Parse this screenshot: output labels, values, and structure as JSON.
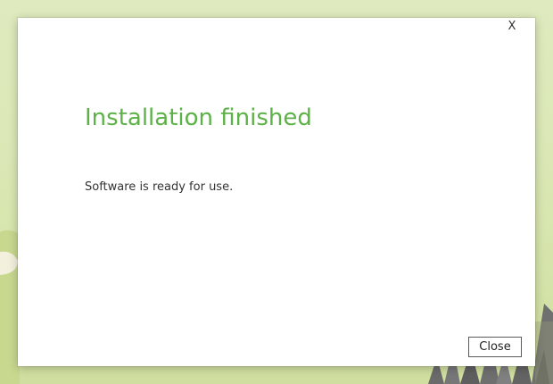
{
  "dialog": {
    "close_glyph": "X",
    "title": "Installation finished",
    "message": "Software is ready for use.",
    "close_button_label": "Close"
  },
  "colors": {
    "title": "#5cb246",
    "background": "#dbe8b6"
  }
}
